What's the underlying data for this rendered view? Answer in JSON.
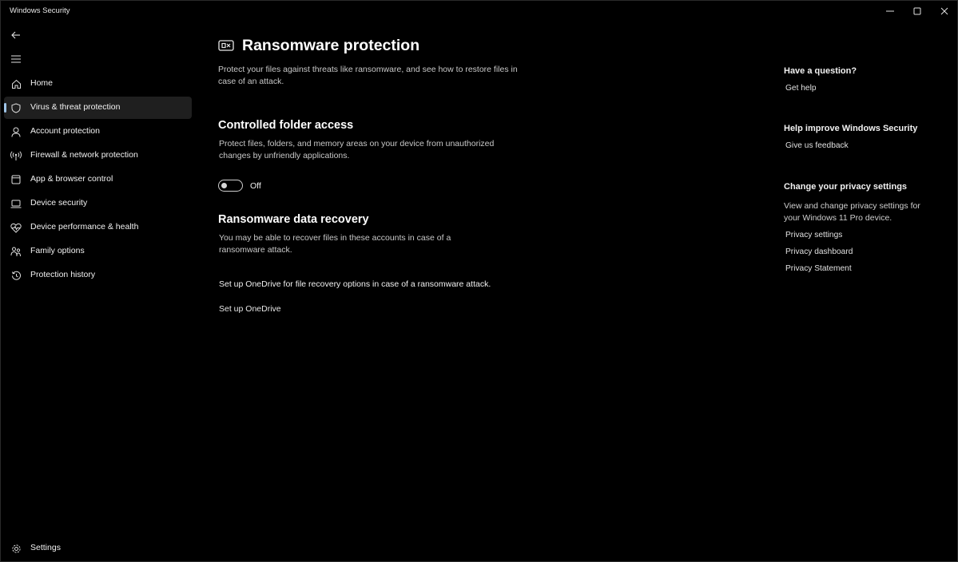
{
  "window": {
    "title": "Windows Security",
    "controls": [
      "minimize",
      "maximize",
      "close"
    ]
  },
  "sidebar": {
    "back_icon": "back-arrow-icon",
    "menu_icon": "hamburger-menu-icon",
    "items": [
      {
        "label": "Home",
        "icon": "home-icon"
      },
      {
        "label": "Virus & threat protection",
        "icon": "shield-icon",
        "selected": true
      },
      {
        "label": "Account protection",
        "icon": "person-icon"
      },
      {
        "label": "Firewall & network protection",
        "icon": "antenna-icon"
      },
      {
        "label": "App & browser control",
        "icon": "app-window-icon"
      },
      {
        "label": "Device security",
        "icon": "laptop-icon"
      },
      {
        "label": "Device performance & health",
        "icon": "heart-pulse-icon"
      },
      {
        "label": "Family options",
        "icon": "family-icon"
      },
      {
        "label": "Protection history",
        "icon": "history-icon"
      }
    ],
    "settings": {
      "label": "Settings",
      "icon": "gear-icon"
    }
  },
  "main": {
    "title": "Ransomware protection",
    "title_icon": "ransomware-icon",
    "description": "Protect your files against threats like ransomware, and see how to restore files in case of an attack.",
    "controlled_folder": {
      "title": "Controlled folder access",
      "description": "Protect files, folders, and memory areas on your device from unauthorized changes by unfriendly applications.",
      "toggle_state": "Off",
      "toggle_on": false
    },
    "recovery": {
      "title": "Ransomware data recovery",
      "description": "You may be able to recover files in these accounts in case of a ransomware attack.",
      "onedrive_text": "Set up OneDrive for file recovery options in case of a ransomware attack.",
      "onedrive_link": "Set up OneDrive"
    }
  },
  "aside": {
    "question": {
      "heading": "Have a question?",
      "link": "Get help"
    },
    "improve": {
      "heading": "Help improve Windows Security",
      "link": "Give us feedback"
    },
    "privacy": {
      "heading": "Change your privacy settings",
      "text": "View and change privacy settings for your Windows 11 Pro device.",
      "links": [
        "Privacy settings",
        "Privacy dashboard",
        "Privacy Statement"
      ]
    }
  },
  "colors": {
    "background": "#000000",
    "selected_item": "#1f1f1f",
    "accent_indicator": "#9fc5e8"
  }
}
